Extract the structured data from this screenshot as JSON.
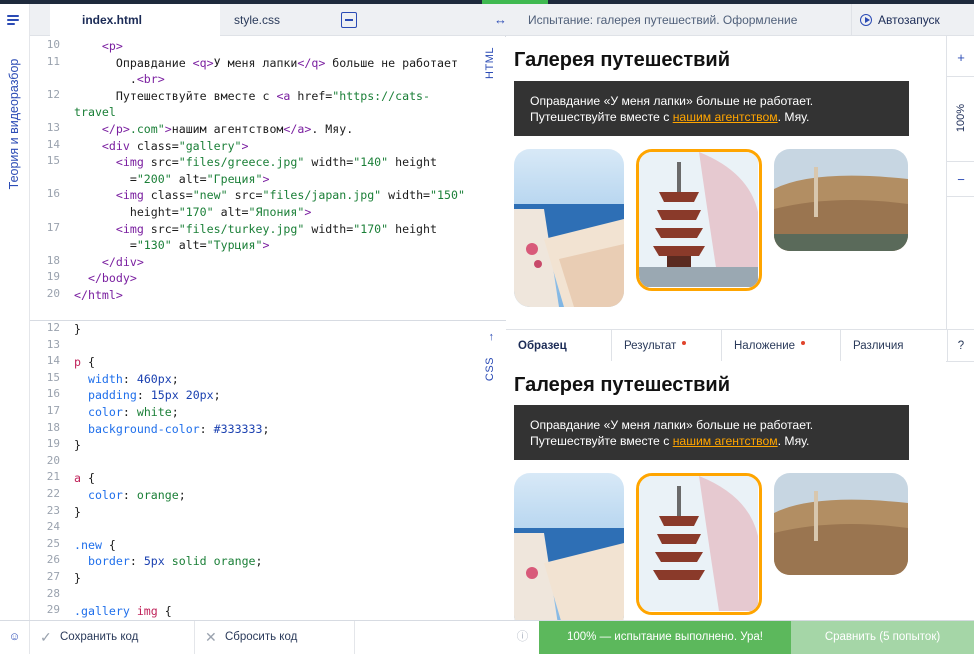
{
  "app": {
    "menu_icon": "menu-icon",
    "rail_label": "Теория и видеоразбор"
  },
  "editor": {
    "tabs": {
      "html_tab": "index.html",
      "css_tab": "style.css",
      "layout_icon": "split-view-icon"
    },
    "html_label": "HTML",
    "css_label": "CSS",
    "css_arrow": "↑",
    "html_lines": [
      {
        "n": "10",
        "html": "    <span class='t-tag'>&lt;p&gt;</span>"
      },
      {
        "n": "11",
        "html": "      Оправдание <span class='t-tag'>&lt;q&gt;</span>У меня лапки<span class='t-tag'>&lt;/q&gt;</span> больше не работает\n        .<span class='t-tag'>&lt;br&gt;</span>"
      },
      {
        "n": "12",
        "html": "      Путешествуйте вместе с <span class='t-tag'>&lt;a</span> href=<span class='t-val'>\"https://cats-travel\n        .com\"</span><span class='t-tag'>&gt;</span>нашим агентством<span class='t-tag'>&lt;/a&gt;</span>. Мяу."
      },
      {
        "n": "13",
        "html": "    <span class='t-tag'>&lt;/p&gt;</span>"
      },
      {
        "n": "14",
        "html": "    <span class='t-tag'>&lt;div</span> class=<span class='t-val'>\"gallery\"</span><span class='t-tag'>&gt;</span>"
      },
      {
        "n": "15",
        "html": "      <span class='t-tag'>&lt;img</span> src=<span class='t-val'>\"files/greece.jpg\"</span> width=<span class='t-val'>\"140\"</span> height\n        =<span class='t-val'>\"200\"</span> alt=<span class='t-val'>\"Греция\"</span><span class='t-tag'>&gt;</span>"
      },
      {
        "n": "16",
        "html": "      <span class='t-tag'>&lt;img</span> class=<span class='t-val'>\"new\"</span> src=<span class='t-val'>\"files/japan.jpg\"</span> width=<span class='t-val'>\"150\"</span>\n        height=<span class='t-val'>\"170\"</span> alt=<span class='t-val'>\"Япония\"</span><span class='t-tag'>&gt;</span>"
      },
      {
        "n": "17",
        "html": "      <span class='t-tag'>&lt;img</span> src=<span class='t-val'>\"files/turkey.jpg\"</span> width=<span class='t-val'>\"170\"</span> height\n        =<span class='t-val'>\"130\"</span> alt=<span class='t-val'>\"Турция\"</span><span class='t-tag'>&gt;</span>"
      },
      {
        "n": "18",
        "html": "    <span class='t-tag'>&lt;/div&gt;</span>"
      },
      {
        "n": "19",
        "html": "  <span class='t-tag'>&lt;/body&gt;</span>"
      },
      {
        "n": "20",
        "html": "<span class='t-tag'>&lt;/html&gt;</span>"
      }
    ],
    "css_lines": [
      {
        "n": "12",
        "html": "}"
      },
      {
        "n": "13",
        "html": ""
      },
      {
        "n": "14",
        "html": "<span class='t-sel'>p</span> {"
      },
      {
        "n": "15",
        "html": "  <span class='t-prop'>width</span>: <span class='t-num'>460px</span>;"
      },
      {
        "n": "16",
        "html": "  <span class='t-prop'>padding</span>: <span class='t-num'>15px 20px</span>;"
      },
      {
        "n": "17",
        "html": "  <span class='t-prop'>color</span>: <span class='t-val'>white</span>;"
      },
      {
        "n": "18",
        "html": "  <span class='t-prop'>background-color</span>: <span class='t-num'>#333333</span>;"
      },
      {
        "n": "19",
        "html": "}"
      },
      {
        "n": "20",
        "html": ""
      },
      {
        "n": "21",
        "html": "<span class='t-sel'>a</span> {"
      },
      {
        "n": "22",
        "html": "  <span class='t-prop'>color</span>: <span class='t-val'>orange</span>;"
      },
      {
        "n": "23",
        "html": "}"
      },
      {
        "n": "24",
        "html": ""
      },
      {
        "n": "25",
        "html": "<span class='t-prop'>.new</span> {"
      },
      {
        "n": "26",
        "html": "  <span class='t-prop'>border</span>: <span class='t-num'>5px</span> <span class='t-val'>solid orange</span>;"
      },
      {
        "n": "27",
        "html": "}"
      },
      {
        "n": "28",
        "html": ""
      },
      {
        "n": "29",
        "html": "<span class='t-prop'>.gallery</span> <span class='t-sel'>img</span> {"
      }
    ]
  },
  "right": {
    "title": "Испытание: галерея путешествий. Оформление",
    "autorun": "Автозапуск",
    "zoom_in": "+",
    "zoom_level": "100%",
    "zoom_out": "−",
    "resize_icon": "↔",
    "preview": {
      "heading": "Галерея путешествий",
      "text_before": "Оправдание «У меня лапки» больше не работает.",
      "text_second": "Путешествуйте вместе с ",
      "link": "нашим агентством",
      "text_after": ". Мяу."
    },
    "tabs": [
      "Образец",
      "Результат",
      "Наложение",
      "Различия",
      "?"
    ]
  },
  "bottom": {
    "chat_icon": "chat-icon",
    "save": "Сохранить код",
    "reset": "Сбросить код",
    "info": "ⓘ",
    "status": "100% — испытание выполнено. Ура!",
    "compare": "Сравнить (5 попыток)"
  },
  "colors": {
    "accent": "#2b4bb5",
    "success": "#5cb85c",
    "success_light": "#a5d6a7",
    "orange": "orange",
    "dark_box": "#333333"
  }
}
